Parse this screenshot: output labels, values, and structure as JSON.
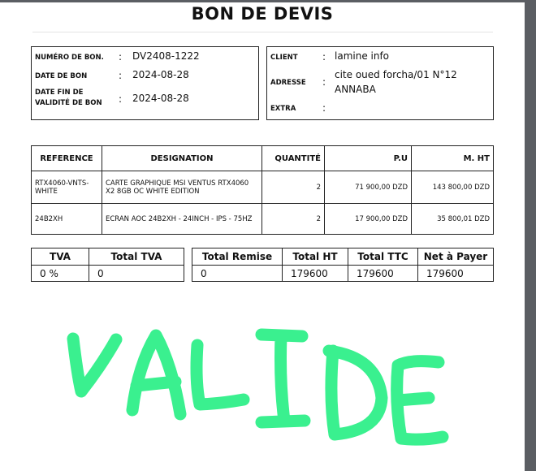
{
  "title": "BON DE DEVIS",
  "bon": {
    "numero_label": "NUMÉRO DE BON.",
    "numero": "DV2408-1222",
    "date_label": "DATE DE BON",
    "date": "2024-08-28",
    "fin_label_1": "DATE FIN DE",
    "fin_label_2": "VALIDITÉ DE BON",
    "fin": "2024-08-28"
  },
  "client": {
    "client_label": "CLIENT",
    "client": "lamine info",
    "adresse_label": "ADRESSE",
    "adresse_1": "cite oued forcha/01 N°12",
    "adresse_2": "ANNABA",
    "extra_label": "EXTRA",
    "extra": "",
    "colon": ":"
  },
  "items": {
    "headers": [
      "REFERENCE",
      "DESIGNATION",
      "QUANTITÉ",
      "P.U",
      "M. HT"
    ],
    "rows": [
      {
        "ref": "RTX4060-VNTS-WHITE",
        "designation": "CARTE GRAPHIQUE MSI VENTUS RTX4060 X2 8GB OC WHITE EDITION",
        "qty": "2",
        "pu": "71 900,00 DZD",
        "mht": "143 800,00 DZD"
      },
      {
        "ref": "24B2XH",
        "designation": "ECRAN AOC 24B2XH - 24INCH - IPS - 75HZ",
        "qty": "2",
        "pu": "17 900,00 DZD",
        "mht": "35 800,01 DZD"
      }
    ]
  },
  "tva": {
    "headers": [
      "TVA",
      "Total TVA"
    ],
    "values": [
      "0 %",
      "0"
    ]
  },
  "totals": {
    "headers": [
      "Total Remise",
      "Total HT",
      "Total TTC",
      "Net à Payer"
    ],
    "values": [
      "0",
      "179600",
      "179600",
      "179600"
    ]
  },
  "stamp": {
    "text": "VALIDE",
    "color": "#3af08f"
  }
}
